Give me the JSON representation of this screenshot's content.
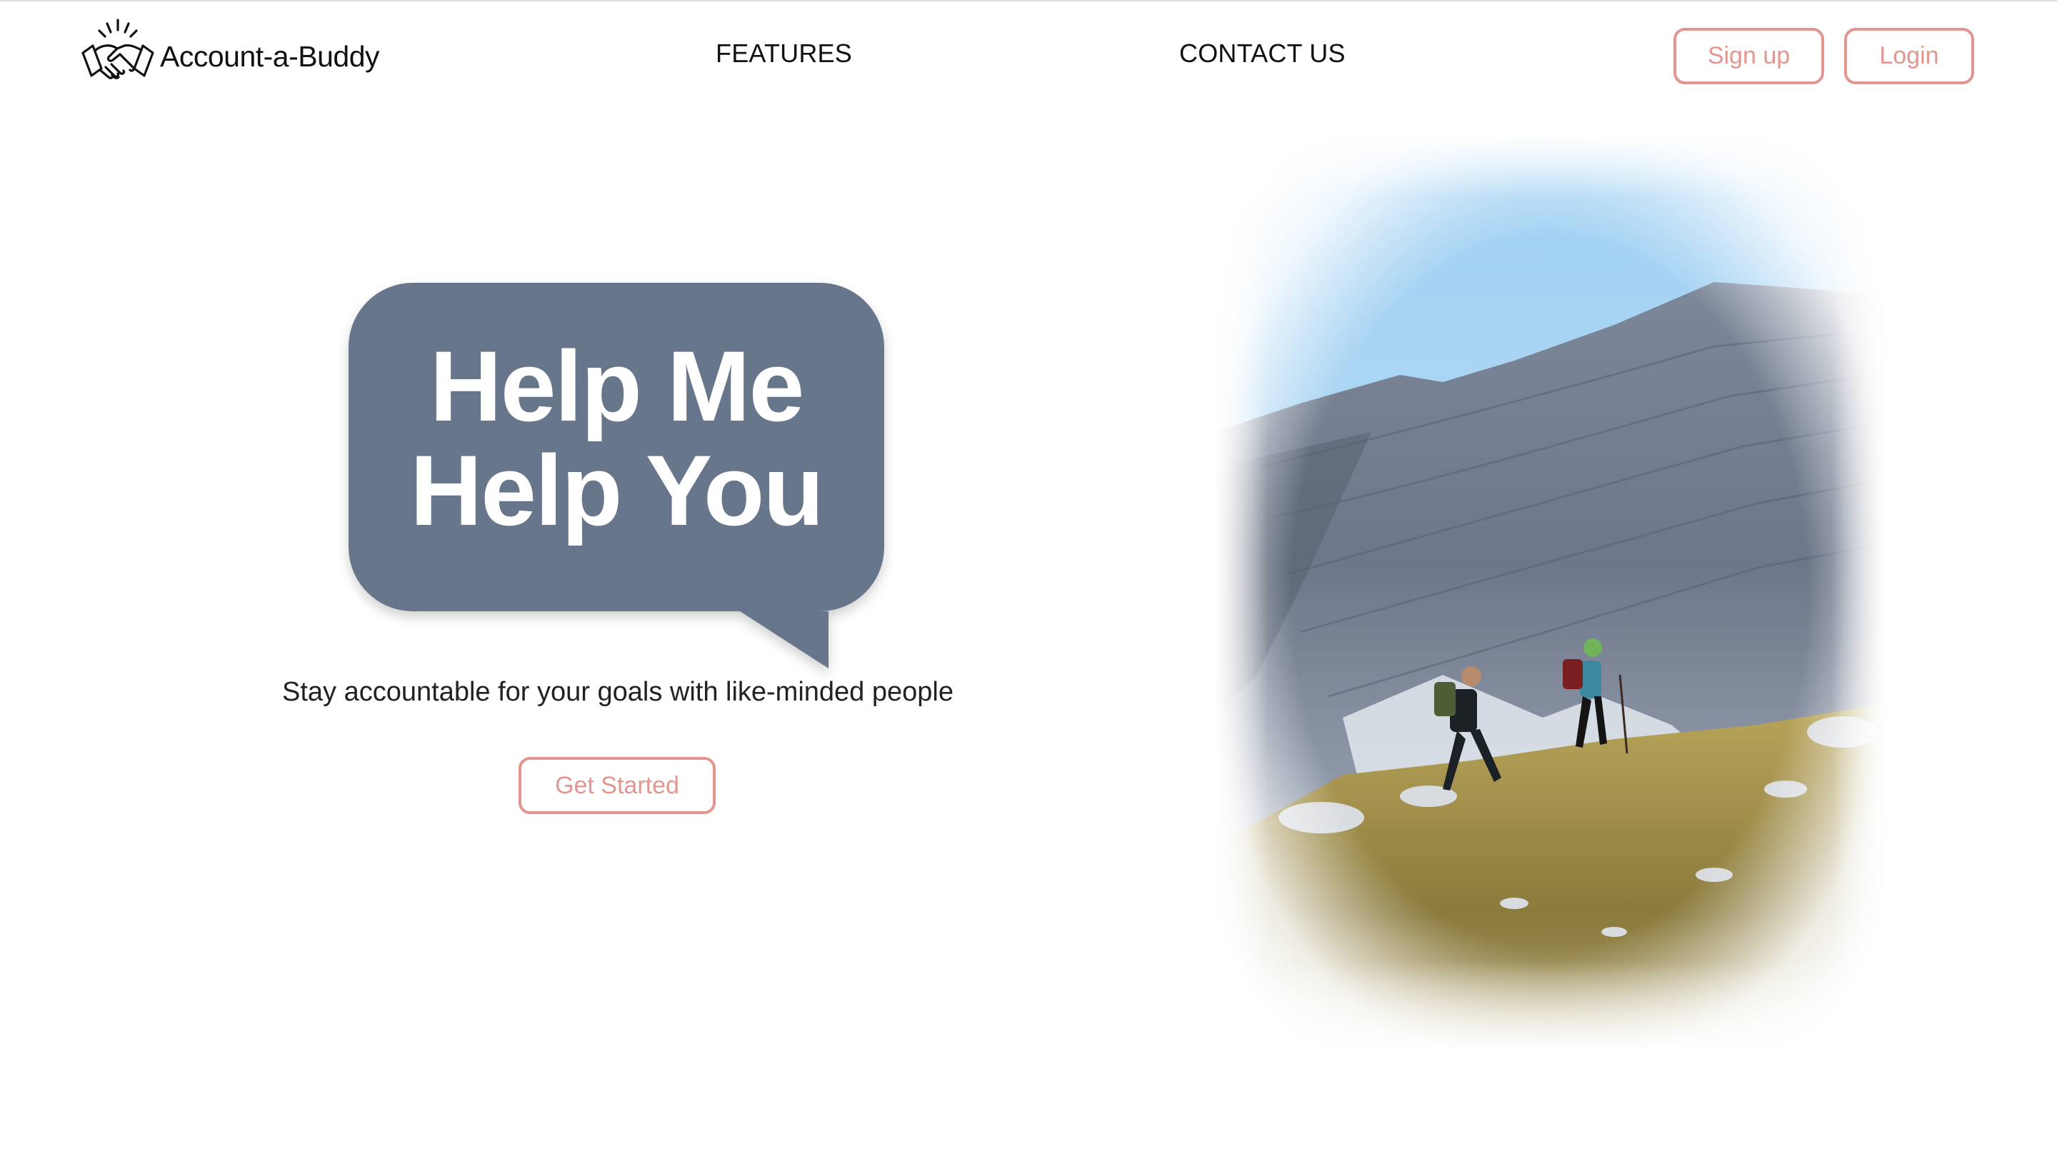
{
  "brand": {
    "name": "Account-a-Buddy",
    "logo_icon": "handshake-icon"
  },
  "nav": {
    "features_label": "FEATURES",
    "contact_label": "CONTACT US",
    "signup_label": "Sign up",
    "login_label": "Login"
  },
  "hero": {
    "headline_line1": "Help Me",
    "headline_line2": "Help You",
    "tagline": "Stay accountable for your goals with like-minded people",
    "cta_label": "Get Started",
    "image_description_icon": "mountain-hikers-photo"
  },
  "colors": {
    "accent": "#e2968f",
    "bubble": "#68768b",
    "text": "#111111",
    "background": "#ffffff"
  }
}
